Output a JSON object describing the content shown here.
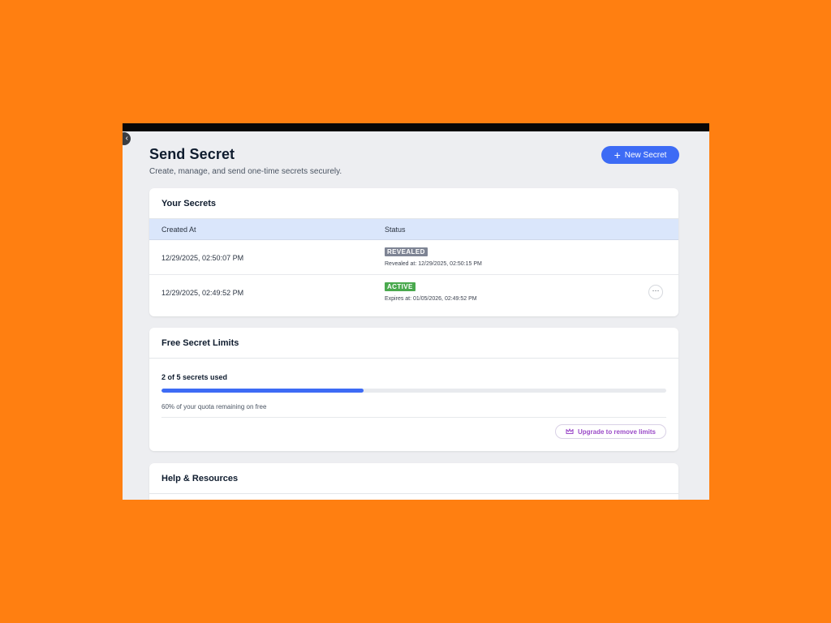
{
  "app": {
    "title": "Send Secret",
    "subtitle": "Create, manage, and send one-time secrets securely.",
    "new_button": "New Secret"
  },
  "secrets": {
    "title": "Your Secrets",
    "columns": [
      "Created At",
      "Status"
    ],
    "rows": [
      {
        "created_at": "12/29/2025, 02:50:07 PM",
        "status": "REVEALED",
        "status_color": "#7E8494",
        "detail": "Revealed at: 12/29/2025, 02:50:15 PM",
        "has_menu": false
      },
      {
        "created_at": "12/29/2025, 02:49:52 PM",
        "status": "ACTIVE",
        "status_color": "#4AA94E",
        "detail": "Expires at: 01/05/2026, 02:49:52 PM",
        "has_menu": true
      }
    ],
    "menu_icon": "ellipsis-icon"
  },
  "limits": {
    "title": "Free Secret Limits",
    "usage": "2 of 5 secrets used",
    "used": 2,
    "total": 5,
    "progress_fraction": 0.4,
    "quota_text": "60% of your quota remaining on free",
    "upgrade_label": "Upgrade to remove limits",
    "upgrade_icon": "crown-icon"
  },
  "help": {
    "title": "Help & Resources"
  },
  "colors": {
    "accent": "#3D6BF5",
    "background": "#FF7F11",
    "upgrade": "#9B4BC8"
  }
}
